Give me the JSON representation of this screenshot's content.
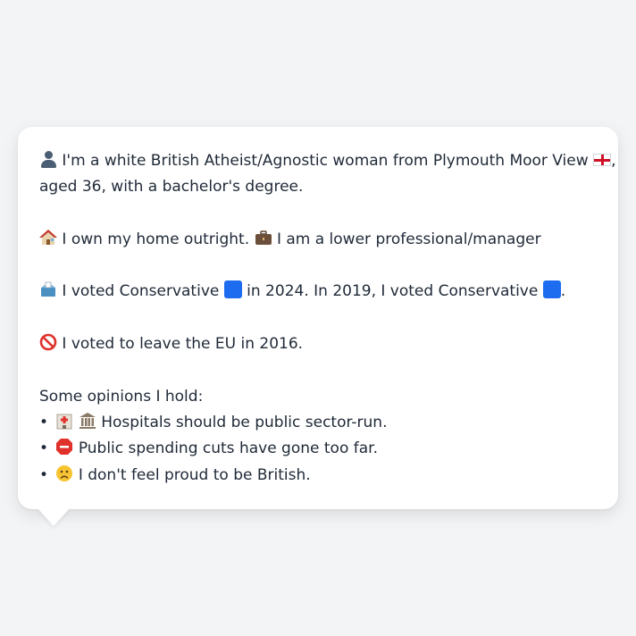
{
  "profile": {
    "line1_text": "I'm a white British Atheist/Agnostic woman from Plymouth Moor View",
    "line1_suffix": ",",
    "line2_text": "aged 36, with a bachelor's degree.",
    "home_text": "I own my home outright.",
    "job_text": "I am a lower professional/manager",
    "vote_text_a": "I voted Conservative",
    "vote_text_b": "in 2024. In 2019, I voted Conservative",
    "vote_text_c": ".",
    "eu_text": "I voted to leave the EU in 2016.",
    "opinions_heading": "Some opinions I hold:",
    "opinions": [
      "Hospitals should be public sector-run.",
      "Public spending cuts have gone too far.",
      "I don't feel proud to be British."
    ],
    "bullet": "•"
  },
  "colors": {
    "background": "#f3f4f6",
    "card": "#ffffff",
    "text": "#1f2937",
    "conservative_blue": "#1d6cf0"
  },
  "icons": {
    "person": "bust-in-silhouette-icon",
    "flag": "england-flag-icon",
    "home": "house-icon",
    "job": "briefcase-icon",
    "vote": "ballot-box-icon",
    "party": "blue-square-icon",
    "eu": "no-entry-icon",
    "opinion1": [
      "hospital-icon",
      "classical-building-icon"
    ],
    "opinion2": "stop-sign-icon",
    "opinion3": "slightly-frowning-face-icon"
  }
}
